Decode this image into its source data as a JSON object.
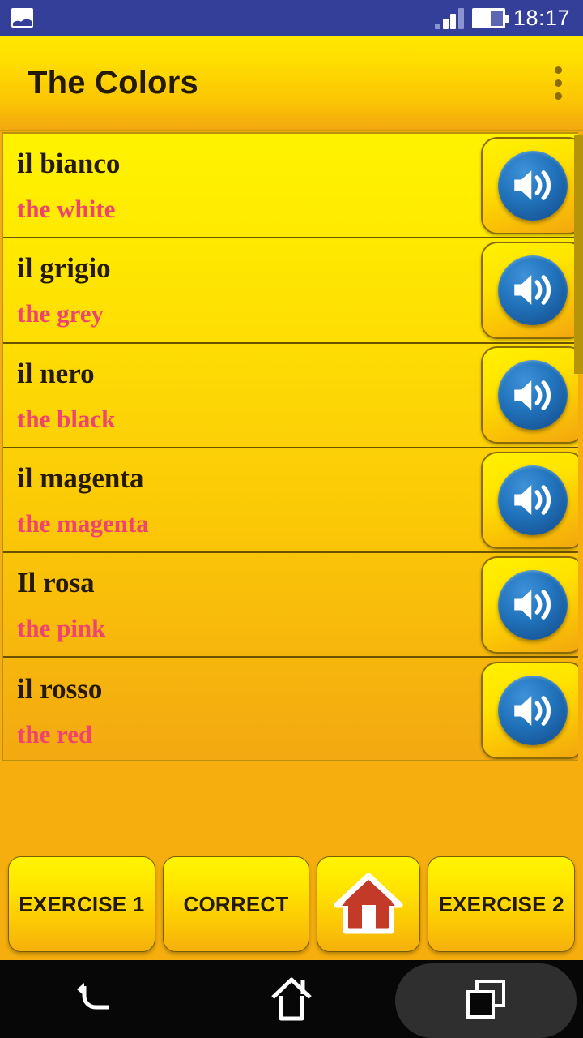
{
  "status_bar": {
    "background_color": "#343F99",
    "notification_icon": "image-icon",
    "signal_icon": "signal-bars-icon",
    "battery_icon": "battery-icon",
    "clock": "18:17"
  },
  "app_bar": {
    "title": "The Colors",
    "overflow_icon": "overflow-menu-icon",
    "accent_color": "#FFDD00"
  },
  "list": {
    "speaker_icon": "speaker-icon",
    "foreign_text_color": "#241a05",
    "native_text_color": "#EF4470",
    "items": [
      {
        "foreign": "il bianco",
        "native": "the white"
      },
      {
        "foreign": "il grigio",
        "native": "the grey"
      },
      {
        "foreign": "il nero",
        "native": "the black"
      },
      {
        "foreign": "il magenta",
        "native": "the magenta"
      },
      {
        "foreign": "Il rosa",
        "native": "the pink"
      },
      {
        "foreign": "il rosso",
        "native": "the red"
      }
    ]
  },
  "bottom_bar": {
    "exercise1_label": "EXERCISE 1",
    "correct_label": "CORRECT",
    "home_icon": "home-house-icon",
    "exercise2_label": "EXERCISE 2"
  },
  "nav_bar": {
    "back_icon": "back-arrow-icon",
    "home_icon": "home-outline-icon",
    "recents_icon": "recents-squares-icon"
  }
}
